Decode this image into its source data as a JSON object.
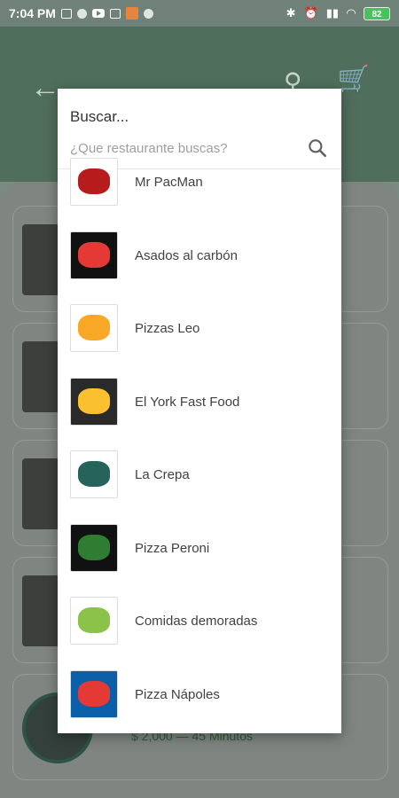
{
  "status_bar": {
    "time": "7:04 PM",
    "battery": "82"
  },
  "app_bar": {
    "back_icon": "arrow-left-icon",
    "search_icon": "search-icon",
    "cart_icon": "cart-icon"
  },
  "background": {
    "price": "$ 2,000",
    "separator": "—",
    "time": "45 Minutos"
  },
  "dialog": {
    "title": "Buscar...",
    "search_placeholder": "¿Que restaurante buscas?",
    "items": [
      {
        "name": "Mr PacMan",
        "logo_bg": "#ffffff",
        "logo_color": "#b71c1c"
      },
      {
        "name": "Asados al carbón",
        "logo_bg": "#111111",
        "logo_color": "#e53935"
      },
      {
        "name": "Pizzas Leo",
        "logo_bg": "#ffffff",
        "logo_color": "#f9a825"
      },
      {
        "name": "El York Fast Food",
        "logo_bg": "#2a2a2a",
        "logo_color": "#fbc02d"
      },
      {
        "name": "La Crepa",
        "logo_bg": "#ffffff",
        "logo_color": "#26635a"
      },
      {
        "name": "Pizza Peroni",
        "logo_bg": "#111111",
        "logo_color": "#2e7d32"
      },
      {
        "name": "Comidas demoradas",
        "logo_bg": "#ffffff",
        "logo_color": "#8bc34a"
      },
      {
        "name": "Pizza Nápoles",
        "logo_bg": "#0b5ea8",
        "logo_color": "#e53935"
      }
    ]
  }
}
